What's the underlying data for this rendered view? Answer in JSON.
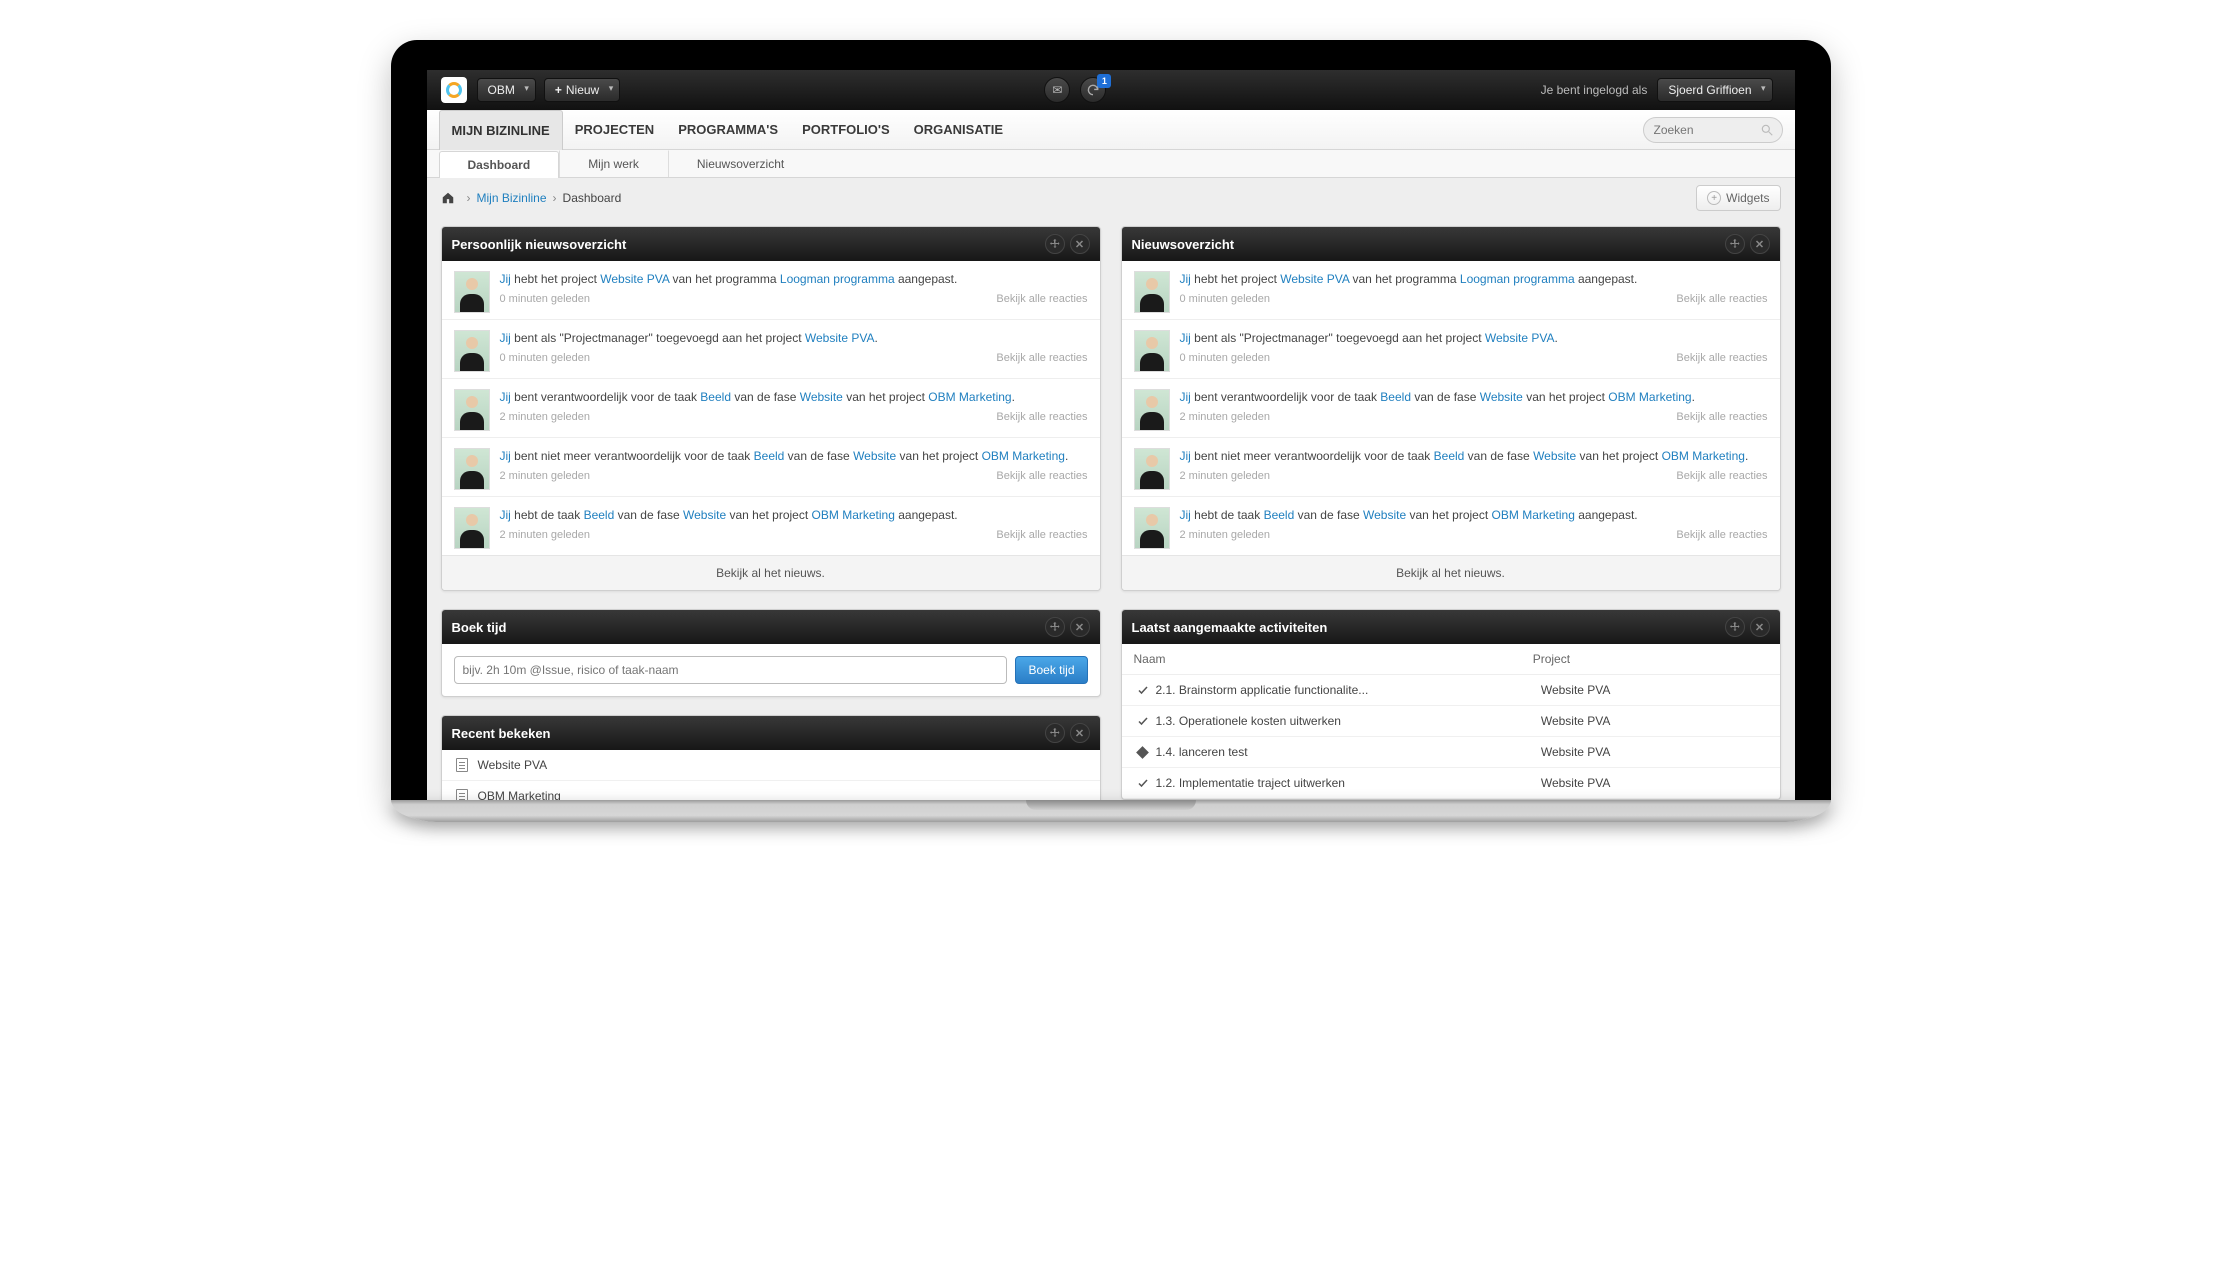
{
  "topbar": {
    "org_label": "OBM",
    "new_label": "Nieuw",
    "notification_count": "1",
    "login_prefix": "Je bent ingelogd als",
    "user_name": "Sjoerd Griffioen"
  },
  "primary_nav": [
    "MIJN BIZINLINE",
    "PROJECTEN",
    "PROGRAMMA'S",
    "PORTFOLIO'S",
    "ORGANISATIE"
  ],
  "search": {
    "placeholder": "Zoeken"
  },
  "sub_tabs": [
    "Dashboard",
    "Mijn werk",
    "Nieuwsoverzicht"
  ],
  "breadcrumb": {
    "link": "Mijn Bizinline",
    "current": "Dashboard"
  },
  "widgets_label": "Widgets",
  "panel_personal_title": "Persoonlijk nieuwsoverzicht",
  "panel_news_title": "Nieuwsoverzicht",
  "panel_book_title": "Boek tijd",
  "panel_recent_title": "Recent bekeken",
  "panel_act_title": "Laatst aangemaakte activiteiten",
  "news_items": [
    {
      "pre1": " hebt het project ",
      "link1": "Website PVA",
      "pre2": " van het programma ",
      "link2": "Loogman programma",
      "post": " aangepast.",
      "time": "0 minuten geleden"
    },
    {
      "pre1": " bent als \"Projectmanager\" toegevoegd aan het project ",
      "link1": "Website PVA",
      "post": ".",
      "time": "0 minuten geleden"
    },
    {
      "pre1": " bent verantwoordelijk voor de taak ",
      "link1": "Beeld",
      "pre2": " van de fase ",
      "link2": "Website",
      "pre3": " van het project ",
      "link3": "OBM Marketing",
      "post": ".",
      "time": "2 minuten geleden"
    },
    {
      "pre1": " bent niet meer verantwoordelijk voor de taak ",
      "link1": "Beeld",
      "pre2": " van de fase ",
      "link2": "Website",
      "pre3": " van het project ",
      "link3": "OBM Marketing",
      "post": ".",
      "time": "2 minuten geleden"
    },
    {
      "pre1": " hebt de taak ",
      "link1": "Beeld",
      "pre2": " van de fase ",
      "link2": "Website",
      "pre3": " van het project ",
      "link3": "OBM Marketing",
      "post": " aangepast.",
      "time": "2 minuten geleden"
    }
  ],
  "jij": "Jij",
  "reactions_label": "Bekijk alle reacties",
  "panel_foot_label": "Bekijk al het nieuws.",
  "book": {
    "placeholder": "bijv. 2h 10m @Issue, risico of taak-naam",
    "button": "Boek tijd"
  },
  "recent": [
    "Website PVA",
    "OBM Marketing"
  ],
  "act": {
    "col1": "Naam",
    "col2": "Project",
    "rows": [
      {
        "icon": "check",
        "name": "2.1. Brainstorm applicatie functionalite...",
        "project": "Website PVA"
      },
      {
        "icon": "check",
        "name": "1.3. Operationele kosten uitwerken",
        "project": "Website PVA"
      },
      {
        "icon": "diamond",
        "name": "1.4. lanceren test",
        "project": "Website PVA"
      },
      {
        "icon": "check",
        "name": "1.2. Implementatie traject uitwerken",
        "project": "Website PVA"
      }
    ]
  }
}
